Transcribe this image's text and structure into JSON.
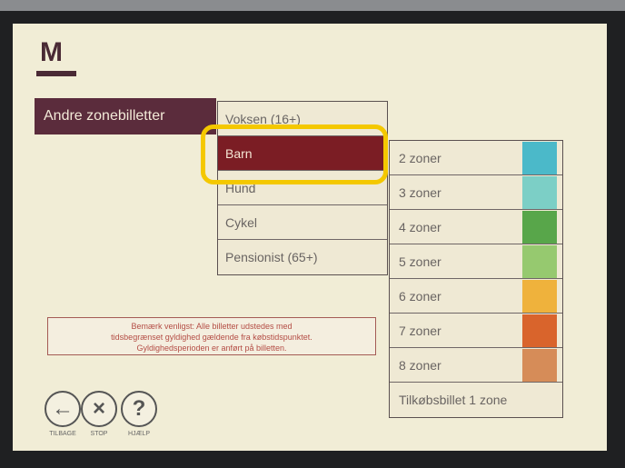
{
  "header": {
    "logo": "M"
  },
  "category": {
    "label": "Andre zonebilletter"
  },
  "tickets": [
    {
      "label": "Voksen (16+)"
    },
    {
      "label": "Barn"
    },
    {
      "label": "Hund"
    },
    {
      "label": "Cykel"
    },
    {
      "label": "Pensionist (65+)"
    }
  ],
  "zones": [
    {
      "label": "2 zoner",
      "color": "#4bb9c9"
    },
    {
      "label": "3 zoner",
      "color": "#7ccfc6"
    },
    {
      "label": "4 zoner",
      "color": "#58a64a"
    },
    {
      "label": "5 zoner",
      "color": "#96c96f"
    },
    {
      "label": "6 zoner",
      "color": "#efb23c"
    },
    {
      "label": "7 zoner",
      "color": "#d9642c"
    },
    {
      "label": "8 zoner",
      "color": "#d68c58"
    },
    {
      "label": "Tilkøbsbillet 1 zone"
    }
  ],
  "notice": {
    "line1": "Bemærk venligst: Alle billetter udstedes med",
    "line2": "tidsbegrænset gyldighed gældende fra købstidspunktet.",
    "line3": "Gyldighedsperioden er anført på billetten."
  },
  "nav": {
    "back_symbol": "←",
    "stop_symbol": "×",
    "help_symbol": "?",
    "back_label": "TILBAGE",
    "stop_label": "STOP",
    "help_label": "HJÆLP"
  }
}
